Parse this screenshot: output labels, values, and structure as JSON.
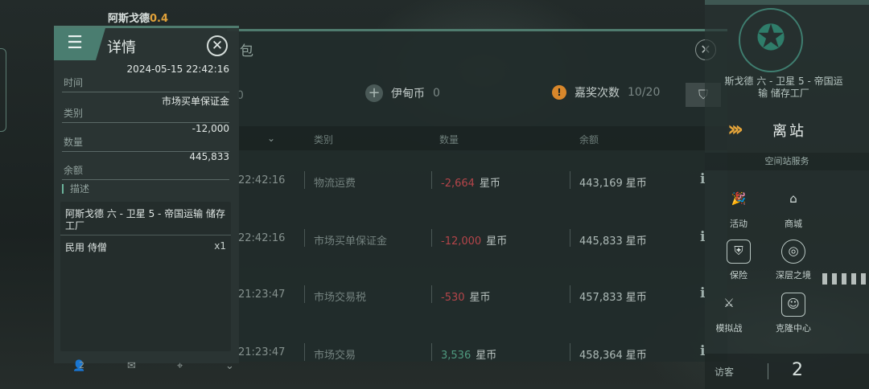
{
  "location": {
    "name": "阿斯戈德",
    "security": "0.4"
  },
  "wallet": {
    "title": "包",
    "currencies": {
      "left_value": "0",
      "isk_label": "伊甸币",
      "isk_value": "0",
      "bonus_label": "嘉奖次数",
      "bonus_value": "10/20"
    },
    "columns": {
      "type": "类别",
      "amount": "数量",
      "balance": "余额"
    },
    "rows": [
      {
        "time": "22:42:16",
        "type": "物流运费",
        "amount": "-2,664",
        "amount_unit": "星币",
        "balance": "443,169",
        "balance_unit": "星币",
        "sign": "neg"
      },
      {
        "time": "22:42:16",
        "type": "市场买单保证金",
        "amount": "-12,000",
        "amount_unit": "星币",
        "balance": "445,833",
        "balance_unit": "星币",
        "sign": "neg"
      },
      {
        "time": "21:23:47",
        "type": "市场交易税",
        "amount": "-530",
        "amount_unit": "星币",
        "balance": "457,833",
        "balance_unit": "星币",
        "sign": "neg"
      },
      {
        "time": "21:23:47",
        "type": "市场交易",
        "amount": "3,536",
        "amount_unit": "星币",
        "balance": "458,364",
        "balance_unit": "星币",
        "sign": "pos"
      }
    ]
  },
  "detail": {
    "title": "详情",
    "fields": {
      "time_label": "时间",
      "time_value": "2024-05-15 22:42:16",
      "type_label": "类别",
      "type_value": "市场买单保证金",
      "amount_label": "数量",
      "amount_value": "-12,000",
      "balance_label": "余额",
      "balance_value": "445,833"
    },
    "description_label": "描述",
    "description_location": "阿斯戈德 六 - 卫星 5 - 帝国运输 储存工厂",
    "item_name": "民用 侍僧",
    "item_qty": "x1"
  },
  "bottom_bar": {
    "count": "2"
  },
  "right_panel": {
    "station": "斯戈德 六 - 卫星 5 - 帝国运输 储存工厂",
    "undock_label": "离站",
    "services_title": "空间站服务",
    "services": [
      "活动",
      "商城",
      "保险",
      "深层之境",
      "模拟战",
      "克隆中心"
    ],
    "visitor_label": "访客",
    "visitor_count": "2"
  },
  "colors": {
    "accent": "#4a7d70",
    "negative": "#b5454a",
    "positive": "#4f9a7f",
    "warning": "#d9872b",
    "undock": "#e6a53a"
  }
}
